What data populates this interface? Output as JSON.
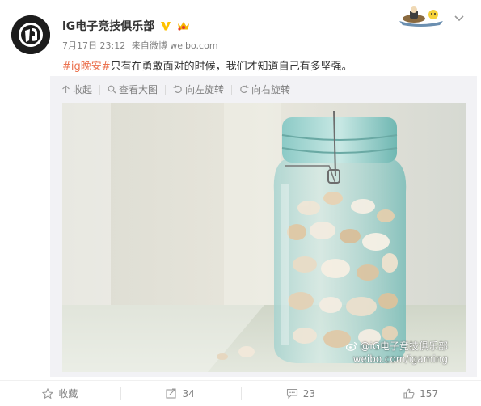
{
  "post": {
    "author": "iG电子竞技俱乐部",
    "date": "7月17日 23:12",
    "source_prefix": "来自",
    "source": "微博 weibo.com",
    "topic": "#ig晚安#",
    "text": "只有在勇敢面对的时候，我们才知道自己有多坚强。"
  },
  "media_toolbar": {
    "collapse": "收起",
    "view_large": "查看大图",
    "rotate_left": "向左旋转",
    "rotate_right": "向右旋转"
  },
  "image": {
    "watermark_line1": "@iG电子竞技俱乐部",
    "watermark_line2": "weibo.com/igaming"
  },
  "footer": {
    "favorite": "收藏",
    "repost_count": "34",
    "comment_count": "23",
    "like_count": "157"
  },
  "colors": {
    "topic": "#eb7350",
    "muted": "#808080",
    "panel_bg": "#f2f2f5",
    "verified": "#ffc200"
  }
}
